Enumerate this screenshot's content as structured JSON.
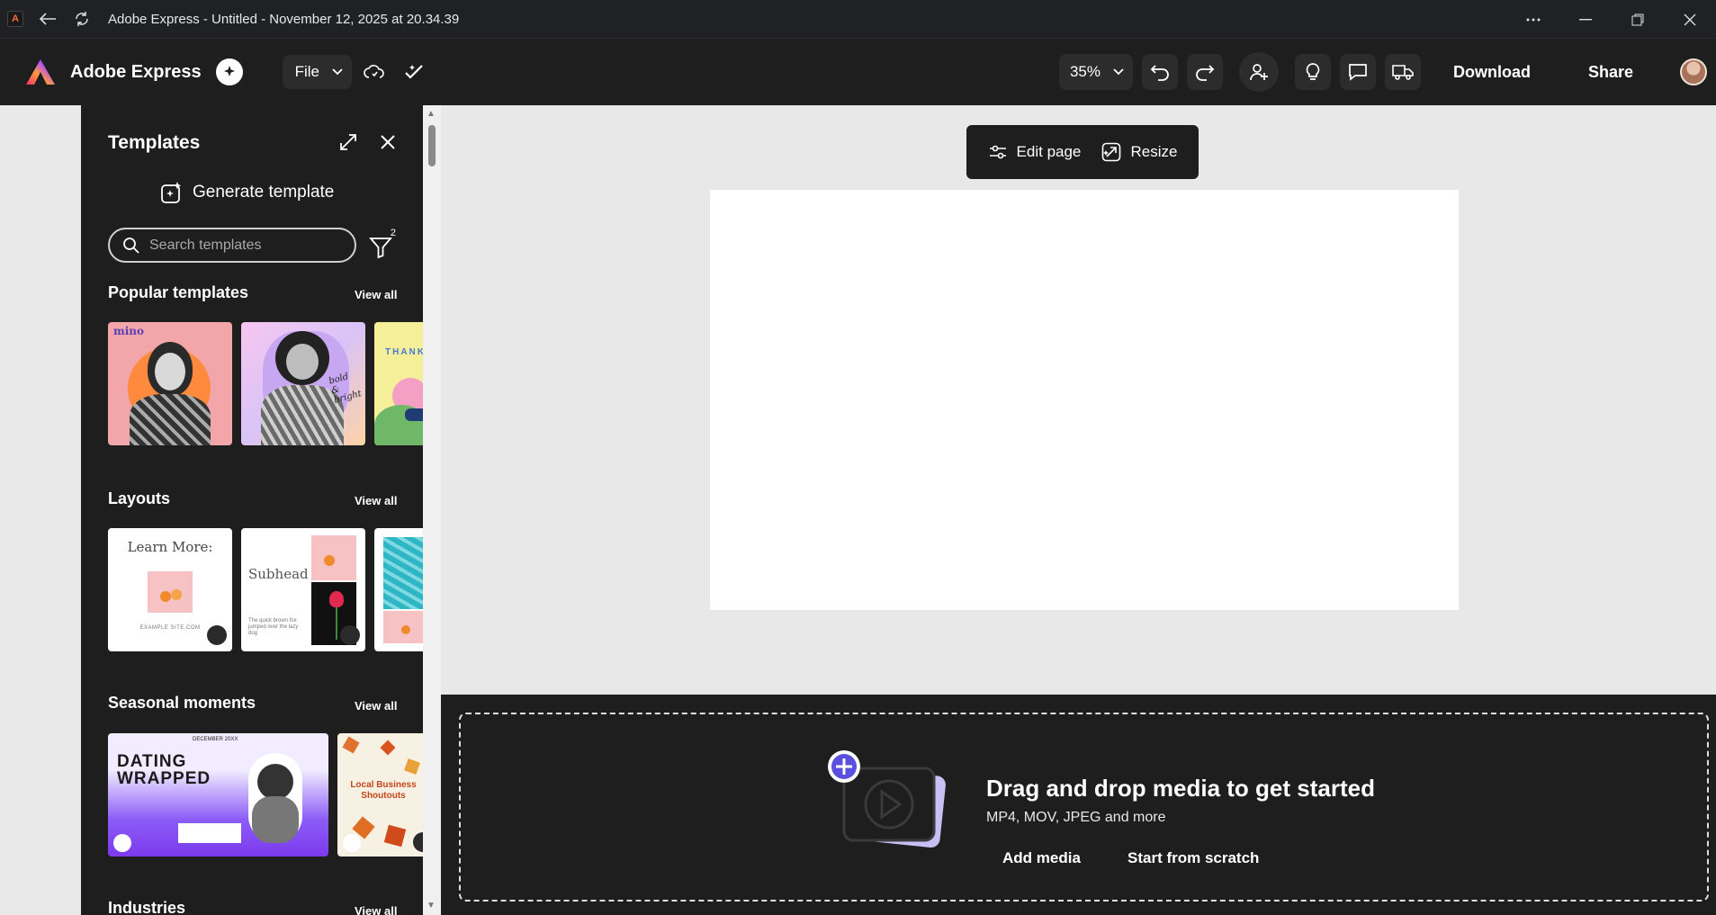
{
  "titlebar": {
    "title": "Adobe Express - Untitled - November 12, 2025 at 20.34.39"
  },
  "header": {
    "brand_name": "Adobe Express",
    "file_label": "File",
    "zoom": "35%",
    "download_label": "Download",
    "share_label": "Share"
  },
  "panel": {
    "title": "Templates",
    "generate_label": "Generate template",
    "search_placeholder": "Search templates",
    "filter_count": "2",
    "sections": {
      "popular": {
        "title": "Popular templates",
        "view_all": "View all"
      },
      "layouts": {
        "title": "Layouts",
        "view_all": "View all"
      },
      "seasonal": {
        "title": "Seasonal moments",
        "view_all": "View all"
      },
      "industries": {
        "title": "Industries",
        "view_all": "View all"
      }
    },
    "thumb_text": {
      "mino": "mino",
      "bold": "bold & bright",
      "thank": "THANK",
      "learn_more": "Learn More:",
      "example_site": "EXAMPLE SITE.COM",
      "subhead": "Subhead",
      "quick_brown": "The quick brown fox jumped over the lazy dog",
      "december": "DECEMBER 20XX",
      "dating_wrapped": "DATING WRAPPED",
      "local_business": "Local Business Shoutouts"
    }
  },
  "canvas": {
    "edit_page_label": "Edit page",
    "resize_label": "Resize"
  },
  "drop": {
    "title": "Drag and drop media to get started",
    "subtitle": "MP4, MOV, JPEG and more",
    "add_media": "Add media",
    "start_scratch": "Start from scratch"
  }
}
